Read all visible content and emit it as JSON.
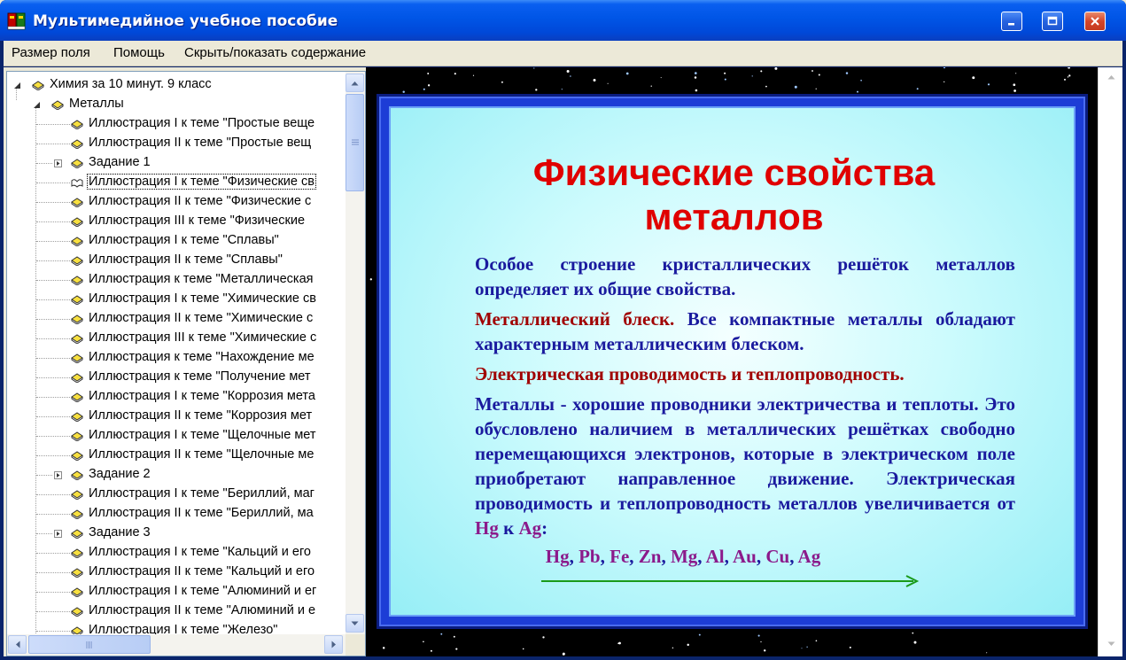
{
  "window": {
    "title": "Мультимедийное учебное пособие"
  },
  "menu": {
    "items": [
      "Размер поля",
      "Помощь",
      "Скрыть/показать содержание"
    ]
  },
  "tree": {
    "root": "Химия за 10 минут. 9 класс",
    "section": "Металлы",
    "items": [
      {
        "label": "Иллюстрация I к теме \"Простые веще",
        "type": "leaf"
      },
      {
        "label": "Иллюстрация II к теме \"Простые вещ",
        "type": "leaf"
      },
      {
        "label": "Задание 1",
        "type": "folder"
      },
      {
        "label": "Иллюстрация I к теме \"Физические св",
        "type": "leaf",
        "selected": true
      },
      {
        "label": "Иллюстрация II к теме \"Физические с",
        "type": "leaf"
      },
      {
        "label": "Иллюстрация III к теме \"Физические",
        "type": "leaf"
      },
      {
        "label": "Иллюстрация I к теме \"Сплавы\"",
        "type": "leaf"
      },
      {
        "label": "Иллюстрация II к теме \"Сплавы\"",
        "type": "leaf"
      },
      {
        "label": "Иллюстрация к теме \"Металлическая",
        "type": "leaf"
      },
      {
        "label": "Иллюстрация I к теме \"Химические св",
        "type": "leaf"
      },
      {
        "label": "Иллюстрация II к теме \"Химические с",
        "type": "leaf"
      },
      {
        "label": "Иллюстрация III к теме \"Химические с",
        "type": "leaf"
      },
      {
        "label": "Иллюстрация к теме \"Нахождение ме",
        "type": "leaf"
      },
      {
        "label": "Иллюстрация к теме \"Получение мет",
        "type": "leaf"
      },
      {
        "label": "Иллюстрация I к теме \"Коррозия мета",
        "type": "leaf"
      },
      {
        "label": "Иллюстрация II к теме \"Коррозия мет",
        "type": "leaf"
      },
      {
        "label": "Иллюстрация I к теме \"Щелочные мет",
        "type": "leaf"
      },
      {
        "label": "Иллюстрация II к теме \"Щелочные ме",
        "type": "leaf"
      },
      {
        "label": "Задание 2",
        "type": "folder"
      },
      {
        "label": "Иллюстрация I к теме \"Бериллий, маг",
        "type": "leaf"
      },
      {
        "label": "Иллюстрация II к теме \"Бериллий, ма",
        "type": "leaf"
      },
      {
        "label": "Задание 3",
        "type": "folder"
      },
      {
        "label": "Иллюстрация I к теме \"Кальций и его",
        "type": "leaf"
      },
      {
        "label": "Иллюстрация II к теме \"Кальций и его",
        "type": "leaf"
      },
      {
        "label": "Иллюстрация I к теме \"Алюминий и ег",
        "type": "leaf"
      },
      {
        "label": "Иллюстрация II к теме \"Алюминий и е",
        "type": "leaf"
      },
      {
        "label": "Иллюстрация I к теме \"Железо\"",
        "type": "leaf"
      }
    ]
  },
  "slide": {
    "title_line1": "Физические свойства",
    "title_line2": "металлов",
    "p1": "Особое строение кристаллических решёток металлов определяет их общие свойства.",
    "p2_head": "Металлический блеск.",
    "p2_body": " Все компактные металлы обладают характерным металлическим блеском.",
    "p3_head": "Электрическая проводимость и теплопроводность.",
    "p4_body": "Металлы - хорошие проводники электричества и теплоты. Это обусловлено наличием в металлических решётках свободно перемещающихся электронов, которые в электрическом поле приобретают направленное движение. Электрическая проводимость и теплопроводность металлов увеличивается от ",
    "p4_from": "Hg",
    "p4_mid": " к ",
    "p4_to": "Ag",
    "p4_end": ":",
    "series": [
      "Hg",
      "Pb",
      "Fe",
      "Zn",
      "Mg",
      "Al",
      "Au",
      "Cu",
      "Ag"
    ],
    "series_separator": ", "
  },
  "colors": {
    "title_red": "#e00000",
    "body_blue": "#1a1a9e",
    "heading_darkred": "#a00000",
    "element_purple": "#8b1a8b",
    "arrow_green": "#1a9a1a"
  }
}
